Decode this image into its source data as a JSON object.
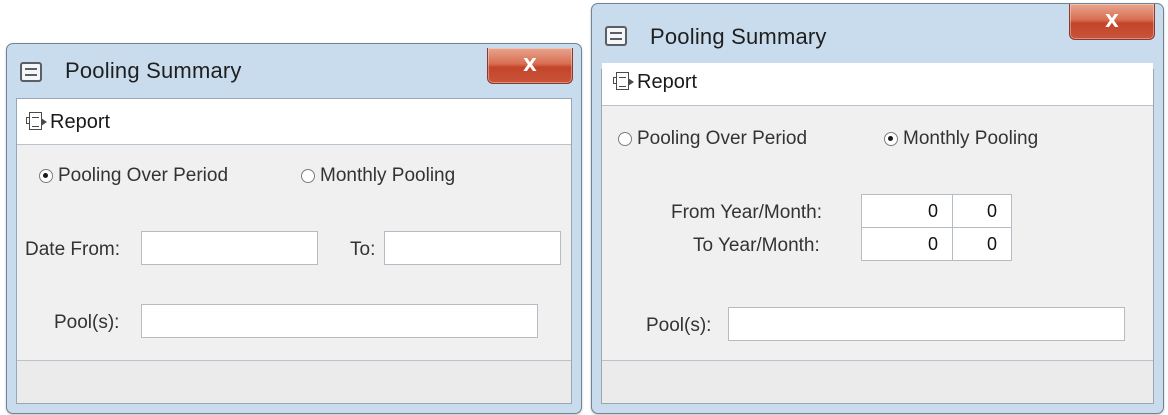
{
  "windows": {
    "left": {
      "title": "Pooling Summary",
      "close_label": "X",
      "toolbar_report": "Report",
      "radio_over_period": "Pooling Over Period",
      "radio_monthly": "Monthly Pooling",
      "selected_option": "Pooling Over Period",
      "date_from_label": "Date From:",
      "date_from_value": "",
      "to_label": "To:",
      "to_value": "",
      "pools_label": "Pool(s):",
      "pools_value": ""
    },
    "right": {
      "title": "Pooling Summary",
      "close_label": "X",
      "toolbar_report": "Report",
      "radio_over_period": "Pooling Over Period",
      "radio_monthly": "Monthly Pooling",
      "selected_option": "Monthly Pooling",
      "from_ym_label": "From Year/Month:",
      "from_year": "0",
      "from_month": "0",
      "to_ym_label": "To Year/Month:",
      "to_year": "0",
      "to_month": "0",
      "pools_label": "Pool(s):",
      "pools_value": ""
    }
  },
  "colors": {
    "window_frame": "#c9dced",
    "close_button": "#c94b30",
    "content_bg": "#f0f0f0"
  },
  "icons": [
    "document-icon",
    "report-icon"
  ]
}
